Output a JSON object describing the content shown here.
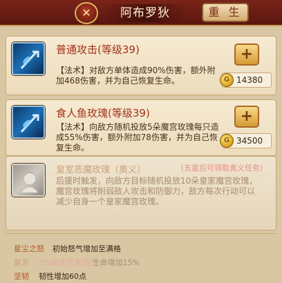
{
  "header": {
    "emblem_glyph": "✕",
    "hero_name": "阿布罗狄",
    "reborn_label": "重 生"
  },
  "skills": [
    {
      "title": "普通攻击(等级39)",
      "desc_lines": [
        "【法术】对敌方单体造成90%伤害，额外附",
        "加468伤害，并为自己恢复生命。"
      ],
      "upgrade_label": "+",
      "cost": "14380",
      "icon": "blue-spear-icon"
    },
    {
      "title": "食人鱼玫瑰(等级39)",
      "desc_lines": [
        "【法术】向敌方随机投放5朵魔宫玫瑰每只造",
        "成55%伤害，额外附加78伤害，并为自己恢",
        "复生命。"
      ],
      "upgrade_label": "+",
      "cost": "34500",
      "icon": "blue-spear-icon"
    }
  ],
  "locked_skill": {
    "title": "皇室恶魔玫瑰（奥义）",
    "hint": "（五星后可领取奥义任务）",
    "desc_lines": [
      "后援时触发，向敌方目标随机投放10朵皇家魔宫玫瑰，",
      "魔宫玫瑰将削弱敌人攻击和防御力，敌方每次行动可以",
      "减少自身一个皇家魔宫玫瑰。"
    ],
    "icon": "hero-portrait-icon"
  },
  "attributes": [
    {
      "label": "星尘之怒",
      "tip": "",
      "value": "初始怒气增加至满格",
      "active": true
    },
    {
      "label": "复苏",
      "tip": "(50级圣衣激活)",
      "value": "生命增加15%",
      "active": false
    },
    {
      "label": "坚韧",
      "tip": "",
      "value": "韧性增加60点",
      "active": true
    }
  ],
  "colors": {
    "header_bg": "#6a1c12",
    "title_red": "#a3301a",
    "coin_gold": "#d9a21b"
  }
}
